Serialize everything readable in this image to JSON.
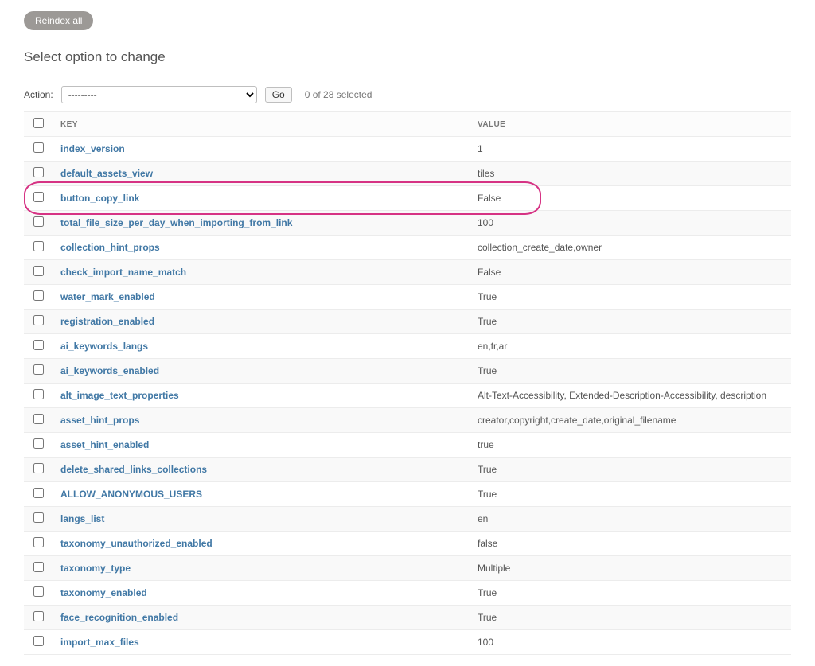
{
  "reindex_label": "Reindex all",
  "page_title": "Select option to change",
  "action_label": "Action:",
  "action_placeholder": "---------",
  "go_label": "Go",
  "selection_count": "0 of 28 selected",
  "headers": {
    "key": "KEY",
    "value": "VALUE"
  },
  "rows": [
    {
      "key": "index_version",
      "value": "1",
      "highlight": false
    },
    {
      "key": "default_assets_view",
      "value": "tiles",
      "highlight": false
    },
    {
      "key": "button_copy_link",
      "value": "False",
      "highlight": true
    },
    {
      "key": "total_file_size_per_day_when_importing_from_link",
      "value": "100",
      "highlight": false
    },
    {
      "key": "collection_hint_props",
      "value": "collection_create_date,owner",
      "highlight": false
    },
    {
      "key": "check_import_name_match",
      "value": "False",
      "highlight": false
    },
    {
      "key": "water_mark_enabled",
      "value": "True",
      "highlight": false
    },
    {
      "key": "registration_enabled",
      "value": "True",
      "highlight": false
    },
    {
      "key": "ai_keywords_langs",
      "value": "en,fr,ar",
      "highlight": false
    },
    {
      "key": "ai_keywords_enabled",
      "value": "True",
      "highlight": false
    },
    {
      "key": "alt_image_text_properties",
      "value": "Alt-Text-Accessibility, Extended-Description-Accessibility, description",
      "highlight": false
    },
    {
      "key": "asset_hint_props",
      "value": "creator,copyright,create_date,original_filename",
      "highlight": false
    },
    {
      "key": "asset_hint_enabled",
      "value": "true",
      "highlight": false
    },
    {
      "key": "delete_shared_links_collections",
      "value": "True",
      "highlight": false
    },
    {
      "key": "ALLOW_ANONYMOUS_USERS",
      "value": "True",
      "highlight": false
    },
    {
      "key": "langs_list",
      "value": "en",
      "highlight": false
    },
    {
      "key": "taxonomy_unauthorized_enabled",
      "value": "false",
      "highlight": false
    },
    {
      "key": "taxonomy_type",
      "value": "Multiple",
      "highlight": false
    },
    {
      "key": "taxonomy_enabled",
      "value": "True",
      "highlight": false
    },
    {
      "key": "face_recognition_enabled",
      "value": "True",
      "highlight": false
    },
    {
      "key": "import_max_files",
      "value": "100",
      "highlight": false
    }
  ]
}
